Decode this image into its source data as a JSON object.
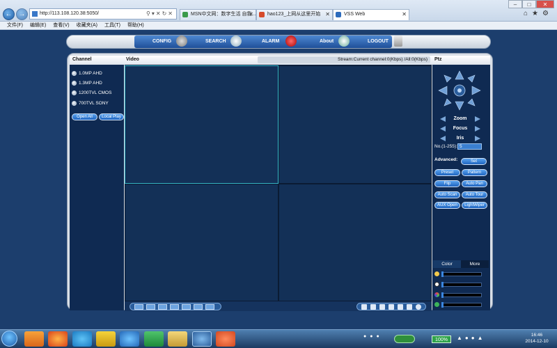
{
  "browser": {
    "url": "http://113.108.120.38:5050/",
    "tabs": [
      "MSN中文网：数字生活 自我...",
      "hao123_上网从这里开始",
      "VSS Web"
    ],
    "menu": [
      "文件(F)",
      "编辑(E)",
      "查看(V)",
      "收藏夹(A)",
      "工具(T)",
      "帮助(H)"
    ]
  },
  "nav": {
    "items": [
      "CONFIG",
      "SEARCH",
      "ALARM",
      "About",
      "LOGOUT"
    ]
  },
  "headers": {
    "channel": "Channel",
    "video": "Video",
    "stream": "Stream:Current channel:0(Kbps) /All:0(Kbps)",
    "ptz": "Ptz"
  },
  "channels": [
    "1.0MP AHD",
    "1.3MP AHD",
    "1200TVL CMOS",
    "700TVL SONY"
  ],
  "channel_buttons": {
    "open_all": "Open All",
    "local_play": "Local Play"
  },
  "ptz": {
    "zoom": "Zoom",
    "focus": "Focus",
    "iris": "Iris",
    "no_label": "No.(1-255):",
    "no_value": "5",
    "advanced": "Advanced:",
    "set": "Set",
    "buttons": [
      "Preset",
      "Pattern",
      "Flip",
      "Auto Pan",
      "Auto Scan",
      "Auto Tour",
      "AUX Open",
      "LightWiper"
    ]
  },
  "color_panel": {
    "tabs": [
      "Color",
      "More"
    ],
    "slider_values": [
      0,
      0,
      0,
      0
    ]
  },
  "taskbar": {
    "zoom": "100%",
    "time": "16:46",
    "date": "2014-12-10"
  },
  "colors": {
    "panel": "#0f2a52",
    "cell": "#133057",
    "selected_border": "#35b7c9",
    "accent": "#1e64c0"
  }
}
